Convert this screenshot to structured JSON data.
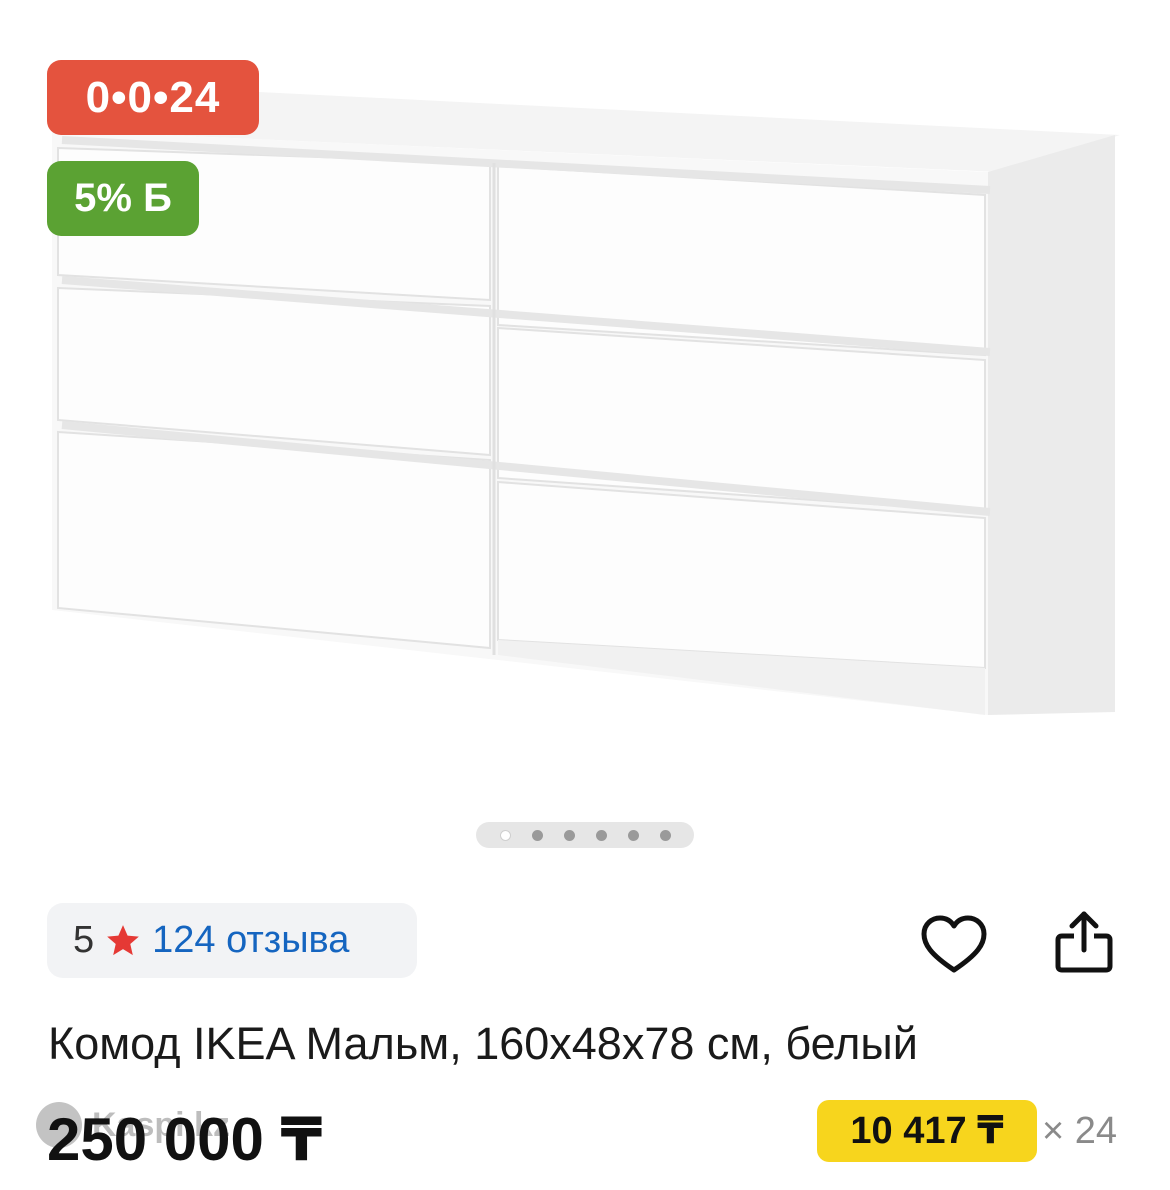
{
  "badges": {
    "installment": "0•0•24",
    "bonus": "5% Б"
  },
  "gallery": {
    "image_subject": "white six-drawer chest of drawers",
    "slide_count": 6,
    "active_slide": 1
  },
  "rating": {
    "value": "5",
    "reviews_text": "124 отзыва"
  },
  "product": {
    "title": "Комод IKEA Мальм, 160x48x78 см, белый",
    "price": "250 000 ₸"
  },
  "installment": {
    "monthly": "10 417 ₸",
    "months": "× 24"
  },
  "watermark": {
    "text": "Kaspi.kz"
  },
  "colors": {
    "installment_badge": "#e4533e",
    "bonus_badge": "#5ba233",
    "monthly_chip": "#f7d51d",
    "link": "#1565c0",
    "star": "#e53935"
  },
  "icons": {
    "favorite": "heart-outline-icon",
    "share": "share-icon",
    "rating": "star-icon"
  }
}
